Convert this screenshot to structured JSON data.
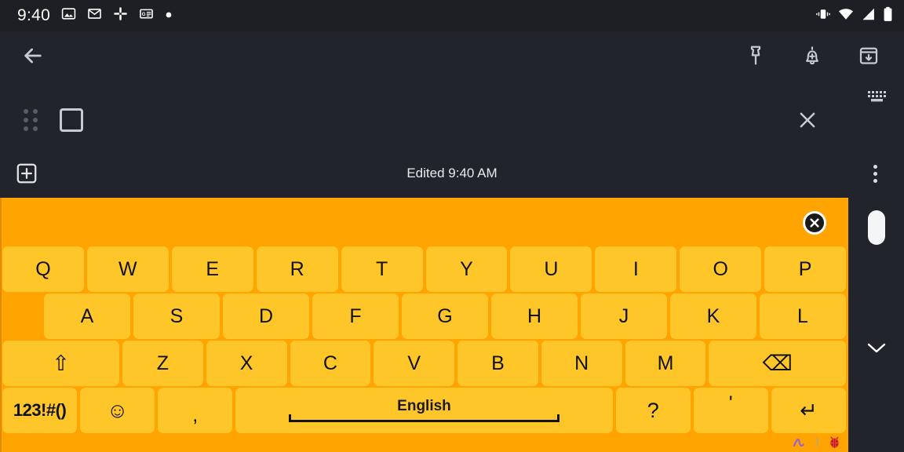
{
  "status_bar": {
    "clock": "9:40",
    "left_icons": [
      "photos-icon",
      "gmail-icon",
      "slack-icon",
      "google-news-icon",
      "dot-icon"
    ],
    "right_icons": [
      "vibrate-icon",
      "wifi-icon",
      "cell-signal-icon",
      "battery-icon"
    ]
  },
  "note_toolbar": {
    "back_icon": "back-arrow-icon",
    "actions": [
      {
        "icon": "pin-icon",
        "label": "Pin note"
      },
      {
        "icon": "add-reminder-icon",
        "label": "Reminder"
      },
      {
        "icon": "archive-icon",
        "label": "Archive"
      }
    ]
  },
  "action_row": {
    "drag_handle_icon": "drag-handle-icon",
    "stop_icon": "stop-square-icon",
    "close_icon": "close-icon",
    "keyboard_indicator_icon": "keyboard-icon"
  },
  "edited_row": {
    "add_icon": "add-box-icon",
    "edited_text": "Edited 9:40 AM",
    "menu_icon": "more-vertical-icon"
  },
  "keyboard": {
    "close_icon": "circled-close-icon",
    "accent": "#ffa400",
    "key_color": "#ffc629",
    "rows": [
      {
        "name": "row-1",
        "keys": [
          {
            "label": "Q"
          },
          {
            "label": "W"
          },
          {
            "label": "E"
          },
          {
            "label": "R"
          },
          {
            "label": "T"
          },
          {
            "label": "Y"
          },
          {
            "label": "U"
          },
          {
            "label": "I"
          },
          {
            "label": "O"
          },
          {
            "label": "P"
          }
        ]
      },
      {
        "name": "row-2",
        "keys": [
          {
            "label": "A"
          },
          {
            "label": "S"
          },
          {
            "label": "D"
          },
          {
            "label": "F"
          },
          {
            "label": "G"
          },
          {
            "label": "H"
          },
          {
            "label": "J"
          },
          {
            "label": "K"
          },
          {
            "label": "L"
          }
        ]
      },
      {
        "name": "row-3",
        "keys": [
          {
            "label": "⇧",
            "name": "shift-key"
          },
          {
            "label": "Z"
          },
          {
            "label": "X"
          },
          {
            "label": "C"
          },
          {
            "label": "V"
          },
          {
            "label": "B"
          },
          {
            "label": "N"
          },
          {
            "label": "M"
          },
          {
            "label": "⌫",
            "name": "backspace-key"
          }
        ]
      },
      {
        "name": "row-4",
        "keys": [
          {
            "label": "123!#()",
            "name": "symbols-key"
          },
          {
            "label": "☺",
            "name": "emoji-key"
          },
          {
            "label": ",",
            "name": "comma-key"
          },
          {
            "label": "English",
            "name": "space-key"
          },
          {
            "label": "?",
            "name": "question-key"
          },
          {
            "label": "'",
            "name": "apostrophe-key"
          },
          {
            "label": "↵",
            "name": "enter-key"
          }
        ]
      }
    ],
    "badges": [
      "squiggle-icon",
      "crescent-moon-icon",
      "ladybug-icon"
    ]
  },
  "right_rail": {
    "handle_icon": "scroll-handle-pill",
    "collapse_icon": "chevron-down-icon"
  }
}
